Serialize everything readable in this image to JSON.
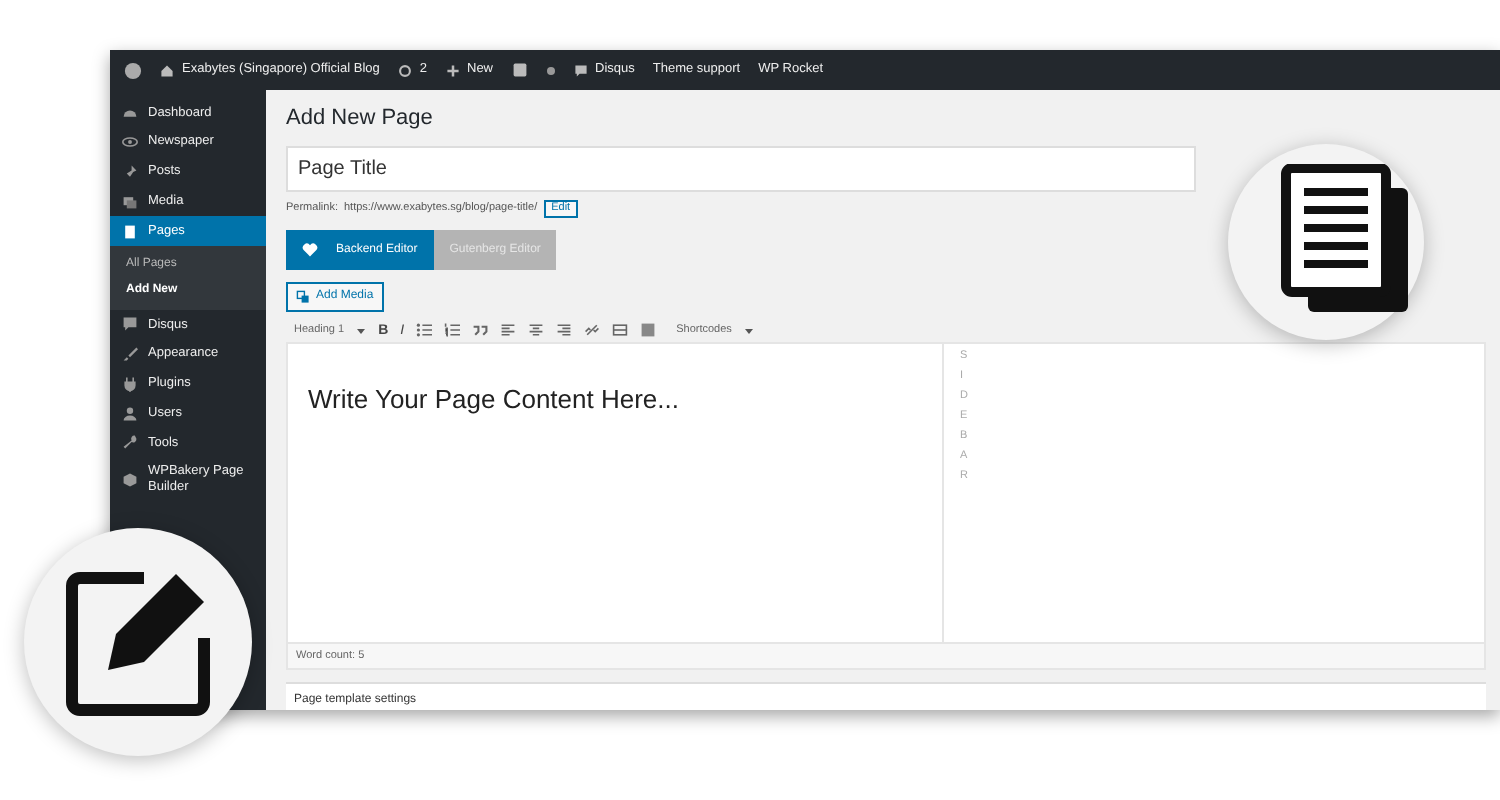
{
  "admin_bar": {
    "site_name": "Exabytes (Singapore) Official Blog",
    "updates": "2",
    "new_label": "New",
    "items": [
      "Disqus",
      "Theme support",
      "WP Rocket"
    ]
  },
  "sidebar": {
    "items": [
      {
        "label": "Dashboard",
        "selected": false
      },
      {
        "label": "Newspaper",
        "selected": false
      },
      {
        "label": "Posts",
        "selected": false
      },
      {
        "label": "Media",
        "selected": false
      },
      {
        "label": "Pages",
        "selected": true,
        "children": [
          {
            "label": "All Pages",
            "selected": false
          },
          {
            "label": "Add New",
            "selected": true
          }
        ]
      },
      {
        "label": "Disqus",
        "selected": false
      },
      {
        "label": "Appearance",
        "selected": false
      },
      {
        "label": "Plugins",
        "selected": false
      },
      {
        "label": "Users",
        "selected": false
      },
      {
        "label": "Tools",
        "selected": false
      },
      {
        "label": "WPBakery Page Builder",
        "selected": false
      }
    ]
  },
  "heading": "Add New Page",
  "title_field": {
    "value": "Page Title"
  },
  "permalink": {
    "label": "Permalink:",
    "url": "https://www.exabytes.sg/blog/page-title/",
    "edit_button": "Edit"
  },
  "editor_switch": [
    {
      "label": "Backend Editor",
      "selected": true
    },
    {
      "label": "Gutenberg Editor",
      "selected": false
    }
  ],
  "add_media": "Add Media",
  "toolbar": {
    "format": "Heading 1",
    "bold": "B",
    "italic": "I",
    "shortcodes": "Shortcodes"
  },
  "content": "Write Your Page Content Here...",
  "sidebar_column": "SIDEBAR",
  "word_count": "Word count: 5",
  "panel_title": "Page template settings"
}
